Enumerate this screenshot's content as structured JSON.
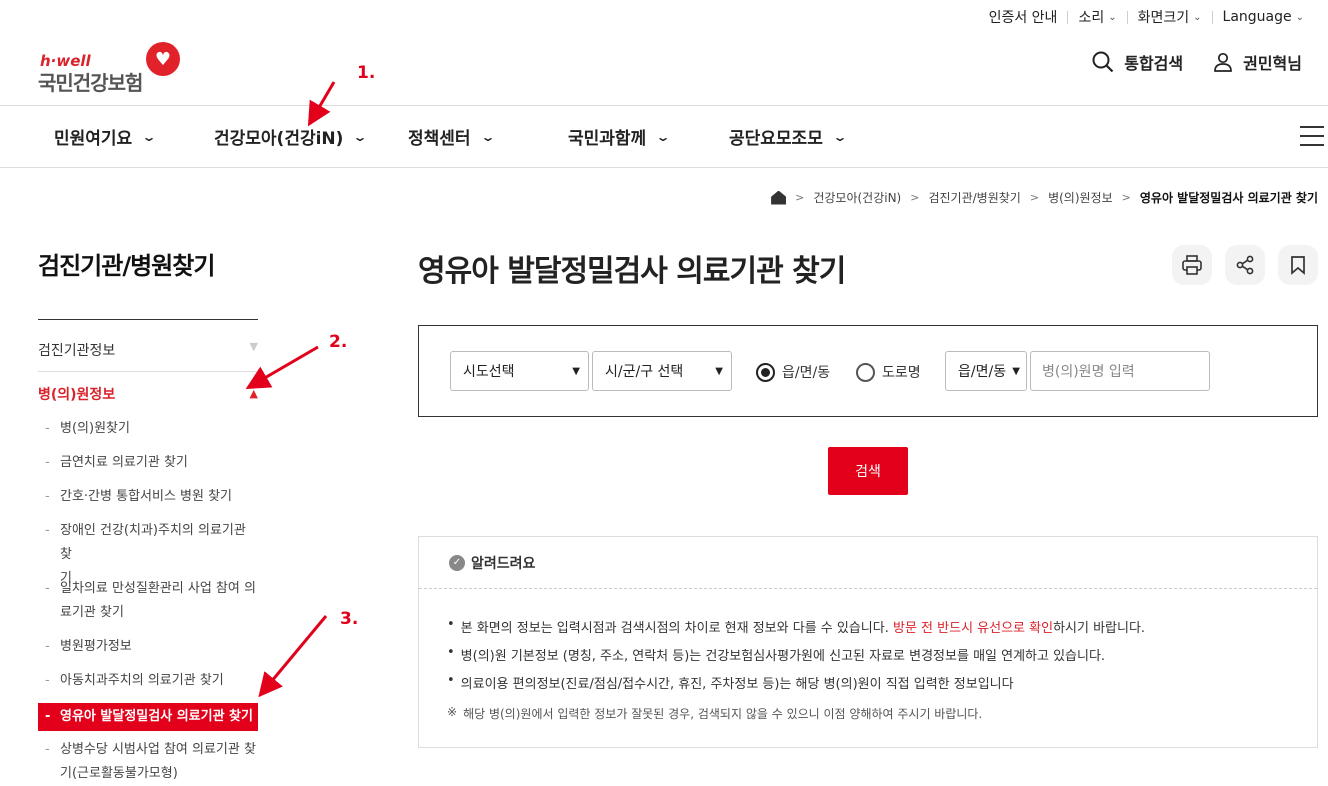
{
  "util": {
    "items": [
      "인증서 안내",
      "소리",
      "화면크기",
      "Language"
    ]
  },
  "logo": {
    "tag": "h·well",
    "name": "국민건강보험"
  },
  "header": {
    "search": "통합검색",
    "user": "권민혁님"
  },
  "gnb": [
    "민원여기요",
    "건강모아(건강iN)",
    "정책센터",
    "국민과함께",
    "공단요모조모"
  ],
  "breadcrumb": [
    "건강모아(건강iN)",
    "검진기관/병원찾기",
    "병(의)원정보",
    "영유아 발달정밀검사 의료기관 찾기"
  ],
  "sidebar": {
    "title": "검진기관/병원찾기",
    "items": [
      "검진기관정보",
      "병(의)원정보"
    ],
    "sub": [
      {
        "label": "병(의)원찾기"
      },
      {
        "label": "금연치료 의료기관 찾기"
      },
      {
        "label": "간호·간병 통합서비스 병원 찾기"
      },
      {
        "label": "장애인 건강(치과)주치의 의료기관 찾",
        "label2": "기"
      },
      {
        "label": "일차의료 만성질환관리 사업 참여 의",
        "label2": "료기관 찾기"
      },
      {
        "label": "병원평가정보"
      },
      {
        "label": "아동치과주치의 의료기관 찾기"
      },
      {
        "label": "영유아 발달정밀검사 의료기관 찾기"
      },
      {
        "label": "상병수당 시범사업 참여 의료기관 찾",
        "label2": "기(근로활동불가모형)"
      }
    ]
  },
  "main": {
    "title": "영유아 발달정밀검사 의료기관 찾기",
    "sido": "시도선택",
    "sigungu": "시/군/구 선택",
    "radio1": "읍/면/동",
    "radio2": "도로명",
    "dong": "읍/면/동",
    "name_placeholder": "병(의)원명 입력",
    "search_button": "검색"
  },
  "notice": {
    "title": "알려드려요",
    "line1a": "본 화면의 정보는 입력시점과 검색시점의 차이로 현재 정보와 다를 수 있습니다.",
    "line1b": "방문 전 반드시 유선으로 확인",
    "line1c": "하시기 바랍니다.",
    "line2": "병(의)원 기본정보 (명칭, 주소, 연락처 등)는 건강보험심사평가원에 신고된 자료로 변경정보를 매일 연계하고 있습니다.",
    "line3": "의료이용 편의정보(진료/점심/접수시간, 휴진, 주차정보 등)는 해당 병(의)원이 직접 입력한 정보입니다",
    "note": "해당 병(의)원에서 입력한 정보가 잘못된 경우, 검색되지 않을 수 있으니 이점 양해하여 주시기 바랍니다."
  },
  "annotations": [
    "1.",
    "2.",
    "3."
  ],
  "colors": {
    "accent": "#e2001a"
  }
}
